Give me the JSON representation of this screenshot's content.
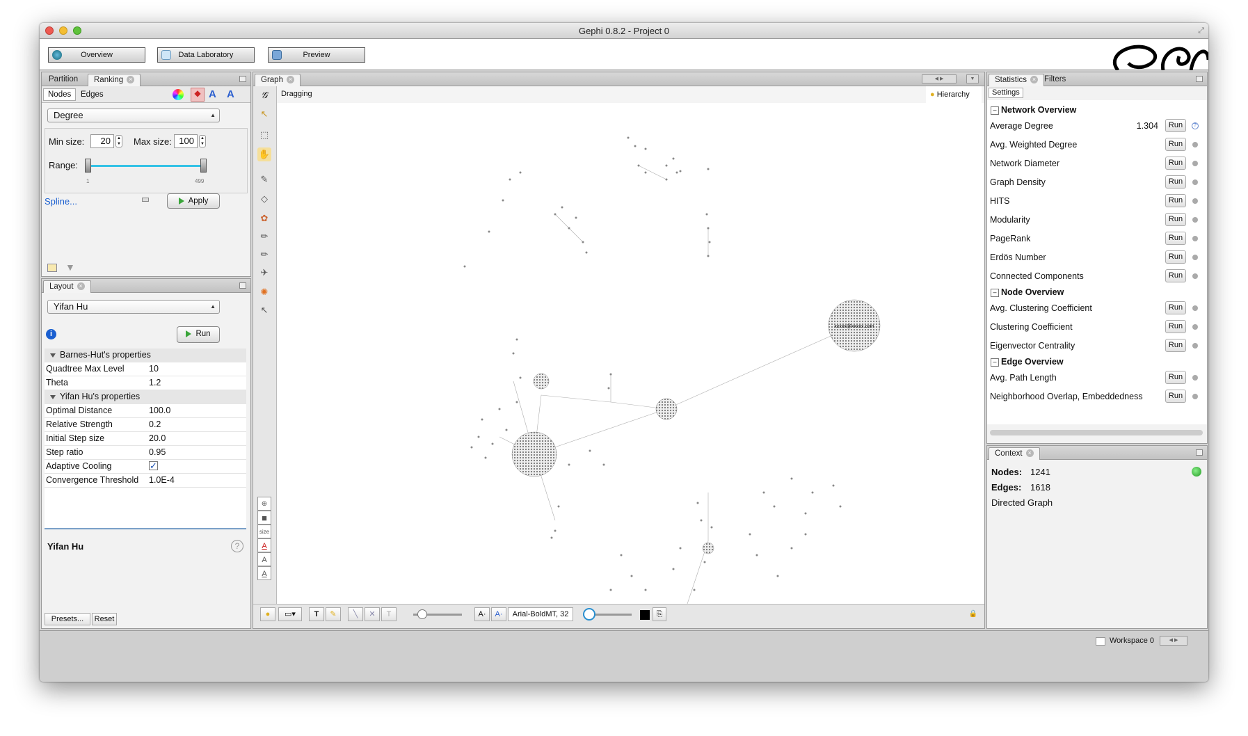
{
  "window": {
    "title": "Gephi 0.8.2 - Project 0"
  },
  "toolbar": {
    "overview": "Overview",
    "data_laboratory": "Data Laboratory",
    "preview": "Preview"
  },
  "ranking_panel": {
    "tabs": [
      "Partition",
      "Ranking"
    ],
    "subtabs": [
      "Nodes",
      "Edges"
    ],
    "attribute": "Degree",
    "min_size_label": "Min size:",
    "min_size": "20",
    "max_size_label": "Max size:",
    "max_size": "100",
    "range_label": "Range:",
    "range_min": "1",
    "range_max": "499",
    "spline": "Spline...",
    "apply": "Apply"
  },
  "layout_panel": {
    "tab": "Layout",
    "algorithm": "Yifan Hu",
    "run": "Run",
    "groups": [
      {
        "name": "Barnes-Hut's properties",
        "props": [
          {
            "k": "Quadtree Max Level",
            "v": "10"
          },
          {
            "k": "Theta",
            "v": "1.2"
          }
        ]
      },
      {
        "name": "Yifan Hu's properties",
        "props": [
          {
            "k": "Optimal Distance",
            "v": "100.0"
          },
          {
            "k": "Relative Strength",
            "v": "0.2"
          },
          {
            "k": "Initial Step size",
            "v": "20.0"
          },
          {
            "k": "Step ratio",
            "v": "0.95"
          },
          {
            "k": "Adaptive Cooling",
            "v": ""
          },
          {
            "k": "Convergence Threshold",
            "v": "1.0E-4"
          }
        ]
      }
    ],
    "description_title": "Yifan Hu",
    "presets": "Presets...",
    "reset": "Reset"
  },
  "graph_panel": {
    "tab": "Graph",
    "mode": "Dragging",
    "hierarchy": "Hierarchy",
    "node_label": "xxxxx@xxxxx.com",
    "font_name": "Arial-BoldMT, 32",
    "size_label": "size"
  },
  "statistics_panel": {
    "tabs": [
      "Statistics",
      "Filters"
    ],
    "settings": "Settings",
    "run_label": "Run",
    "network_overview": {
      "title": "Network Overview",
      "items": [
        {
          "label": "Average Degree",
          "value": "1.304"
        },
        {
          "label": "Avg. Weighted Degree",
          "value": ""
        },
        {
          "label": "Network Diameter",
          "value": ""
        },
        {
          "label": "Graph Density",
          "value": ""
        },
        {
          "label": "HITS",
          "value": ""
        },
        {
          "label": "Modularity",
          "value": ""
        },
        {
          "label": "PageRank",
          "value": ""
        },
        {
          "label": "Erdös Number",
          "value": ""
        },
        {
          "label": "Connected Components",
          "value": ""
        }
      ]
    },
    "node_overview": {
      "title": "Node Overview",
      "items": [
        {
          "label": "Avg. Clustering Coefficient"
        },
        {
          "label": "Clustering Coefficient"
        },
        {
          "label": "Eigenvector Centrality"
        }
      ]
    },
    "edge_overview": {
      "title": "Edge Overview",
      "items": [
        {
          "label": "Avg. Path Length"
        },
        {
          "label": "Neighborhood Overlap, Embeddedness"
        }
      ]
    }
  },
  "context_panel": {
    "tab": "Context",
    "nodes_label": "Nodes:",
    "nodes": "1241",
    "edges_label": "Edges:",
    "edges": "1618",
    "graph_type": "Directed Graph"
  },
  "statusbar": {
    "workspace": "Workspace 0"
  },
  "colors": {
    "accent_blue": "#1a5fd0",
    "run_green": "#3aa53a",
    "slider_cyan": "#33c2e6"
  }
}
